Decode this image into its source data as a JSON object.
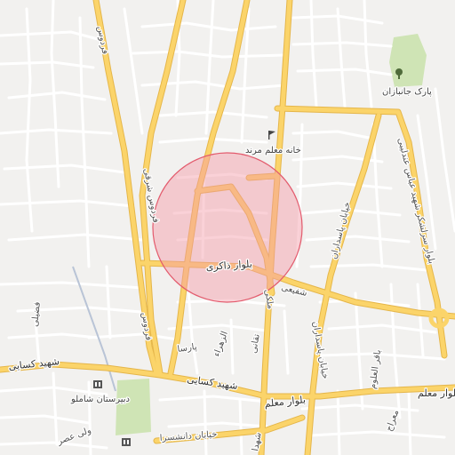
{
  "map": {
    "colors": {
      "background": "#f2f1ef",
      "minor_street": "#ffffff",
      "major_road": "#fbd46a",
      "major_road_casing": "#e5b64a",
      "park": "#cfe4b5",
      "highlight_fill": "#f39aa6",
      "highlight_stroke": "#e35b6d"
    },
    "labels": {
      "ferdows_north": "فردوس",
      "ferdows_sharghi": "فردوس شرقی",
      "ferdows_south": "فردوس",
      "park": "پارک جانبازان",
      "khane_moalem": "خانه معلم مرند",
      "bolvar_zakeri": "بلوار ذاکری",
      "shafiei": "شفیعی",
      "pasdaran_north": "خیابان پاسداران",
      "pasdaran_south": "خیابان پاسداران",
      "abbas_ardabili": "بلوار سرلشکر شهید عباس عندلیبی",
      "maleki": "ملکی",
      "fazeli": "فضیلی",
      "parsa": "پارسا",
      "alzahra": "الزهراء",
      "taghani": "تقانی",
      "shahid_kasaei_west": "شهید کسایی",
      "shahid_kasaei_mid": "شهید کسایی",
      "bolvar_moalem": "بلوار معلم",
      "bolvar_moalem_east": "بلوار معلم",
      "dabirestan": "دبیرستان شاملو",
      "daneshsara": "خیابان دانشسرا",
      "valiasr": "ولی عصر",
      "bagher_olum": "باقر العلوم",
      "shohada": "شهدا",
      "meraj": "معراج"
    }
  }
}
